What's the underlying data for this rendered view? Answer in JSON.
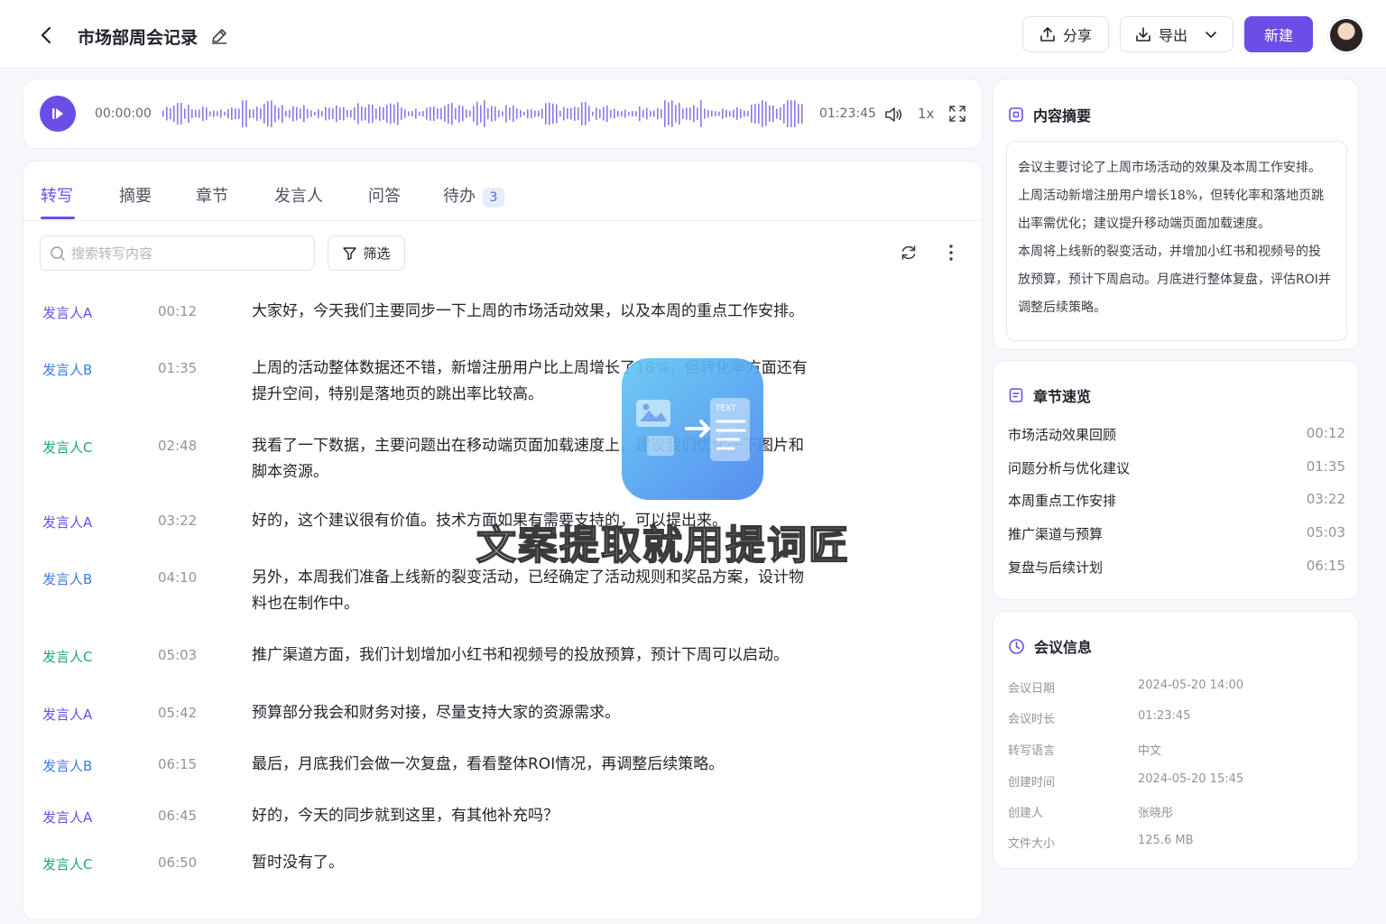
{
  "header": {
    "title": "市场部周会记录",
    "share_label": "分享",
    "export_label": "导出",
    "new_label": "新建"
  },
  "player": {
    "current_time": "00:00:00",
    "total_time": "01:23:45",
    "speed": "1x",
    "playback_progress": 0
  },
  "tabs": [
    {
      "label": "转写"
    },
    {
      "label": "摘要"
    },
    {
      "label": "章节"
    },
    {
      "label": "发言人"
    },
    {
      "label": "问答"
    },
    {
      "label": "待办",
      "badge": "3"
    }
  ],
  "toolbar": {
    "search_placeholder": "搜索转写内容",
    "filter_label": "筛选"
  },
  "transcript": [
    {
      "speaker": "发言人A",
      "time": "00:12",
      "text": "大家好，今天我们主要同步一下上周的市场活动效果，以及本周的重点工作安排。"
    },
    {
      "speaker": "发言人B",
      "time": "01:35",
      "text": "上周的活动整体数据还不错，新增注册用户比上周增长了18%，但转化率方面还有提升空间，特别是落地页的跳出率比较高。"
    },
    {
      "speaker": "发言人C",
      "time": "02:48",
      "text": "我看了一下数据，主要问题出在移动端页面加载速度上，建议我们优化一下图片和脚本资源。"
    },
    {
      "speaker": "发言人A",
      "time": "03:22",
      "text": "好的，这个建议很有价值。技术方面如果有需要支持的，可以提出来。"
    },
    {
      "speaker": "发言人B",
      "time": "04:10",
      "text": "另外，本周我们准备上线新的裂变活动，已经确定了活动规则和奖品方案，设计物料也在制作中。"
    },
    {
      "speaker": "发言人C",
      "time": "05:03",
      "text": "推广渠道方面，我们计划增加小红书和视频号的投放预算，预计下周可以启动。"
    },
    {
      "speaker": "发言人A",
      "time": "05:42",
      "text": "预算部分我会和财务对接，尽量支持大家的资源需求。"
    },
    {
      "speaker": "发言人B",
      "time": "06:15",
      "text": "最后，月底我们会做一次复盘，看看整体ROI情况，再调整后续策略。"
    },
    {
      "speaker": "发言人A",
      "time": "06:45",
      "text": "好的，今天的同步就到这里，有其他补充吗？"
    },
    {
      "speaker": "发言人C",
      "time": "06:50",
      "text": "暂时没有了。"
    }
  ],
  "speaker_colors": {
    "发言人A": "#6b4ee6",
    "发言人B": "#3a7be0",
    "发言人C": "#1fa86a"
  },
  "summary": {
    "title": "内容摘要",
    "lines": [
      "会议主要讨论了上周市场活动的效果及本周工作安排。",
      "上周活动新增注册用户增长18%，但转化率和落地页跳",
      "出率需优化；建议提升移动端页面加载速度。",
      "本周将上线新的裂变活动，并增加小红书和视频号的投",
      "放预算，预计下周启动。月底进行整体复盘，评估ROI并",
      "调整后续策略。"
    ]
  },
  "chapters": {
    "title": "章节速览",
    "items": [
      {
        "title": "市场活动效果回顾",
        "time": "00:12"
      },
      {
        "title": "问题分析与优化建议",
        "time": "01:35"
      },
      {
        "title": "本周重点工作安排",
        "time": "03:22"
      },
      {
        "title": "推广渠道与预算",
        "time": "05:03"
      },
      {
        "title": "复盘与后续计划",
        "time": "06:15"
      }
    ]
  },
  "meeting_info": {
    "title": "会议信息",
    "rows": [
      {
        "label": "会议日期",
        "value": "2024-05-20 14:00"
      },
      {
        "label": "会议时长",
        "value": "01:23:45"
      },
      {
        "label": "转写语言",
        "value": "中文"
      },
      {
        "label": "创建时间",
        "value": "2024-05-20 15:45"
      },
      {
        "label": "创建人",
        "value": "张晓彤"
      },
      {
        "label": "文件大小",
        "value": "125.6 MB"
      }
    ]
  },
  "overlay": {
    "logo_text": "TEXT",
    "caption": "文案提取就用提词匠"
  },
  "colors": {
    "accent": "#6b4ee6",
    "background": "#f6f7fb"
  }
}
